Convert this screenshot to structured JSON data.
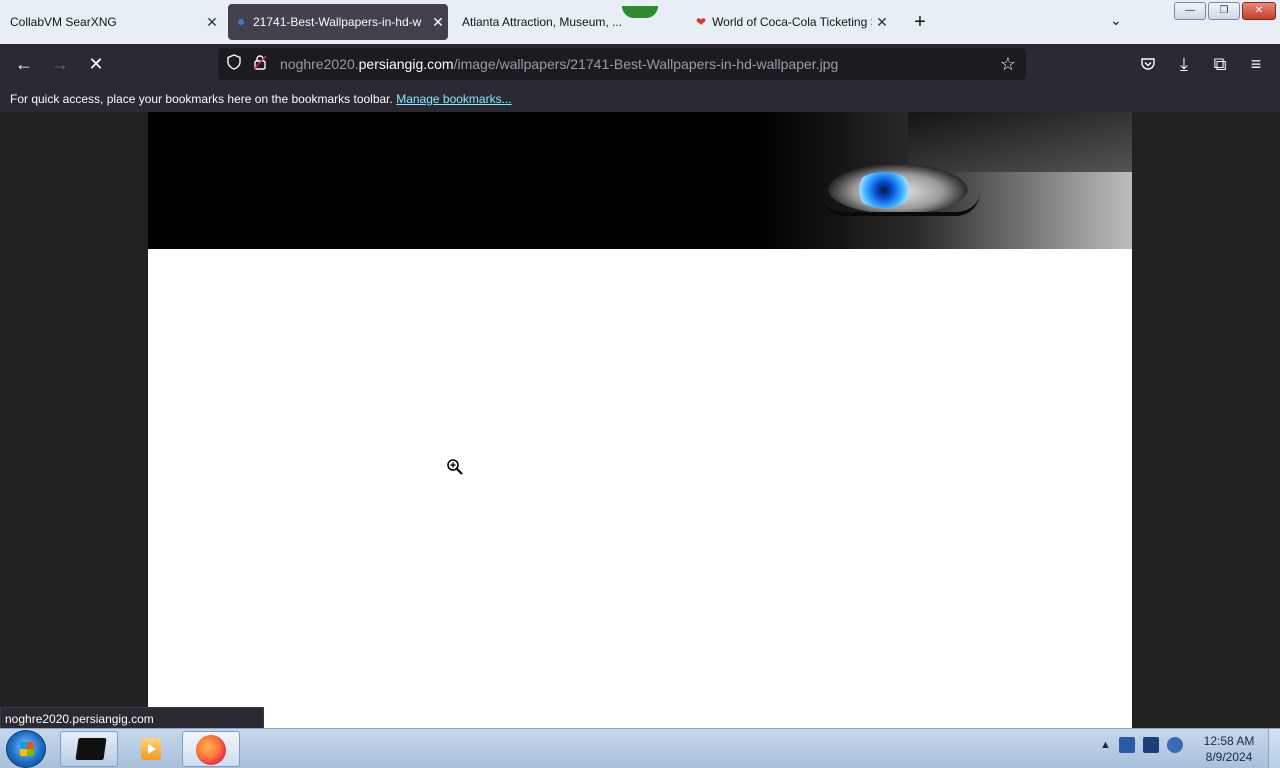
{
  "browser": {
    "tabs": [
      {
        "label": "CollabVM SearXNG",
        "active": false
      },
      {
        "label": "21741-Best-Wallpapers-in-hd-w",
        "active": true
      },
      {
        "label": "Atlanta Attraction, Museum, ...",
        "active": false
      },
      {
        "label": "World of Coca-Cola Ticketing S",
        "active": false
      }
    ],
    "new_tab_symbol": "+",
    "list_tabs_symbol": "⌄",
    "close_tab_symbol": "✕"
  },
  "window_controls": {
    "minimize": "—",
    "restore": "❐",
    "close": "✕"
  },
  "navbar": {
    "back_icon": "←",
    "forward_icon": "→",
    "stop_icon": "✕",
    "url_host_prefix": "noghre2020.",
    "url_host": "persiangig.com",
    "url_path": "/image/wallpapers/21741-Best-Wallpapers-in-hd-wallpaper.jpg",
    "bookmark_star": "☆",
    "pocket_icon": "◡",
    "download_icon": "⤓",
    "extensions_icon": "⧉",
    "menu_icon": "≡"
  },
  "bookmarks_bar": {
    "message": "For quick access, place your bookmarks here on the bookmarks toolbar.",
    "link": "Manage bookmarks..."
  },
  "status": {
    "text": "noghre2020.persiangig.com"
  },
  "taskbar": {
    "time": "12:58 AM",
    "date": "8/9/2024",
    "tray_arrow": "▲"
  },
  "colors": {
    "navbar_bg": "#2b2a33",
    "urlbar_bg": "#1c1b22",
    "link": "#80ebff",
    "content_bg": "#222222"
  }
}
